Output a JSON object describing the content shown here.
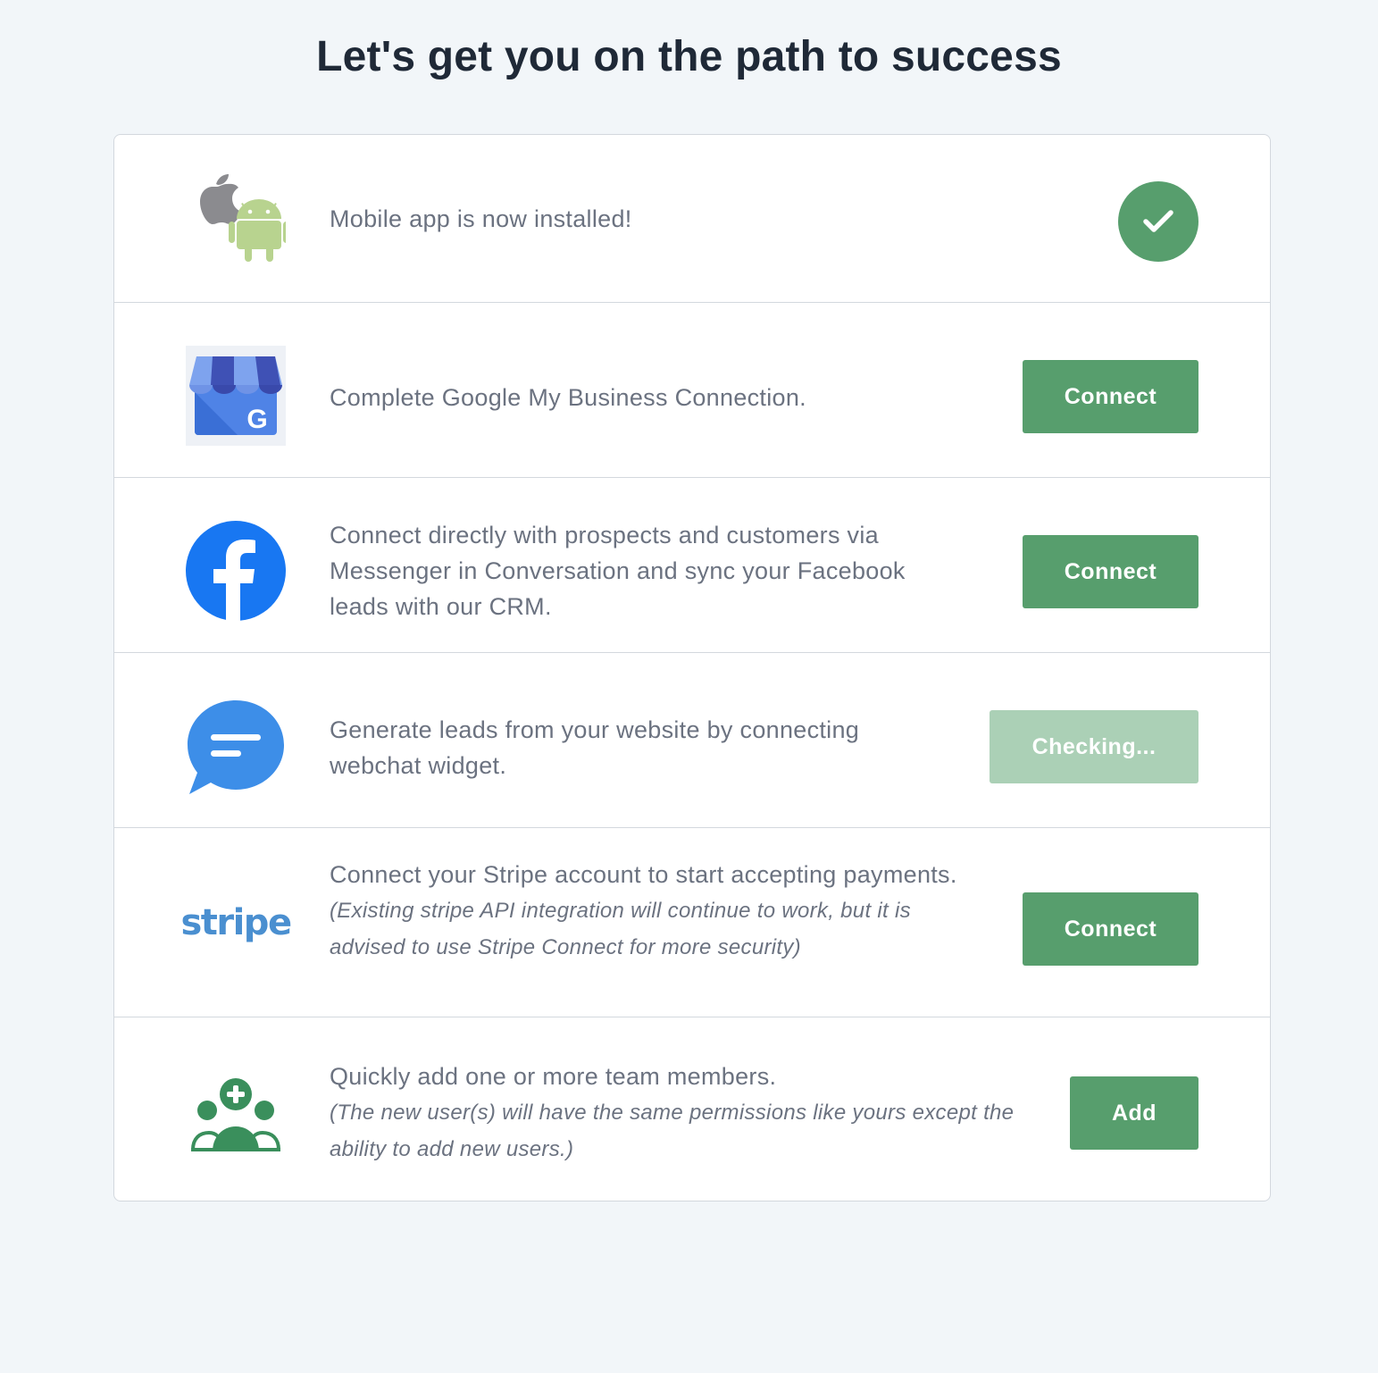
{
  "page": {
    "title": "Let's get you on the path to success"
  },
  "colors": {
    "background": "#f2f6f9",
    "primary_green": "#579e6d",
    "disabled_green": "#abd0b6",
    "title_text": "#1f2937",
    "body_text": "#6b7280",
    "facebook_blue": "#1877f2",
    "chat_blue": "#3d8ee8",
    "stripe_blue": "#4a8fd0"
  },
  "steps": [
    {
      "icon": "apple-android-icon",
      "text": "Mobile app is now installed!",
      "status": "completed",
      "status_icon": "check-icon"
    },
    {
      "icon": "google-my-business-icon",
      "text": "Complete Google My Business Connection.",
      "button": "Connect"
    },
    {
      "icon": "facebook-icon",
      "text": "Connect directly with prospects and customers via Messenger in Conversation and sync your Facebook leads with our CRM.",
      "button": "Connect"
    },
    {
      "icon": "webchat-icon",
      "text": "Generate leads from your website by connecting webchat widget.",
      "button": "Checking...",
      "button_state": "disabled"
    },
    {
      "icon": "stripe-logo",
      "logo_text": "stripe",
      "text": "Connect your Stripe account to start accepting payments.",
      "note": "(Existing stripe API integration will continue to work, but it is advised to use Stripe Connect for more security)",
      "button": "Connect"
    },
    {
      "icon": "add-team-icon",
      "text": "Quickly add one or more team members.",
      "note": "(The new user(s) will have the same permissions like yours except the ability to add new users.)",
      "button": "Add"
    }
  ]
}
